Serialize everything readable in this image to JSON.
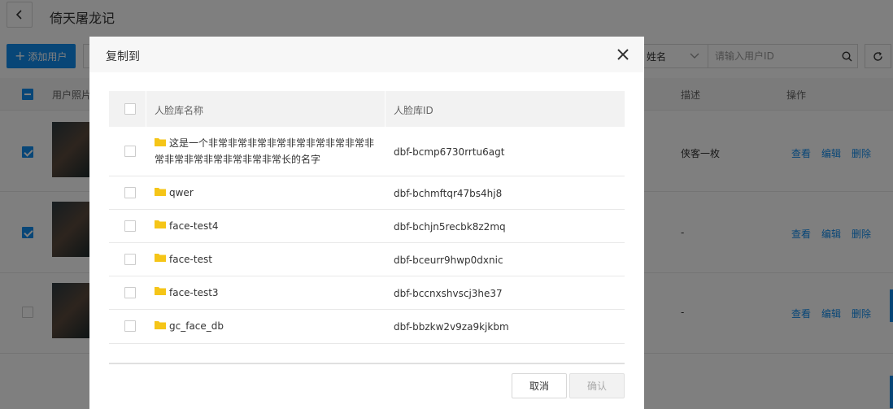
{
  "page": {
    "title": "倚天屠龙记",
    "add_user_label": "添加用户",
    "search": {
      "select_value": "姓名",
      "placeholder": "请输入用户ID"
    },
    "table": {
      "headers": {
        "photo": "用户照片",
        "desc": "描述",
        "ops": "操作"
      },
      "rows": [
        {
          "checked": true,
          "desc": "侠客一枚",
          "view": "查看",
          "edit": "编辑",
          "delete": "删除"
        },
        {
          "checked": true,
          "desc": "-",
          "view": "查看",
          "edit": "编辑",
          "delete": "删除"
        },
        {
          "checked": false,
          "desc": "-",
          "view": "查看",
          "edit": "编辑",
          "delete": "删除"
        }
      ]
    }
  },
  "dialog": {
    "title": "复制到",
    "columns": {
      "name": "人脸库名称",
      "id": "人脸库ID"
    },
    "rows": [
      {
        "name": "这是一个非常非常非常非常非常非常非常非常非常非常非常非常非常非常非常长的名字",
        "id": "dbf-bcmp6730rrtu6agt"
      },
      {
        "name": "qwer",
        "id": "dbf-bchmftqr47bs4hj8"
      },
      {
        "name": "face-test4",
        "id": "dbf-bchjn5recbk8z2mq"
      },
      {
        "name": "face-test",
        "id": "dbf-bceurr9hwp0dxnic"
      },
      {
        "name": "face-test3",
        "id": "dbf-bccnxshvscj3he37"
      },
      {
        "name": "gc_face_db",
        "id": "dbf-bbzkw2v9za9kjkbm"
      }
    ],
    "cancel_label": "取消",
    "confirm_label": "确认"
  },
  "colors": {
    "accent": "#108cee",
    "folder": "#f5c518",
    "overlay": "rgba(0,0,0,0.5)"
  },
  "icons": [
    "back-arrow-icon",
    "plus-icon",
    "chevron-down-icon",
    "search-icon",
    "refresh-icon",
    "close-icon",
    "folder-icon"
  ]
}
